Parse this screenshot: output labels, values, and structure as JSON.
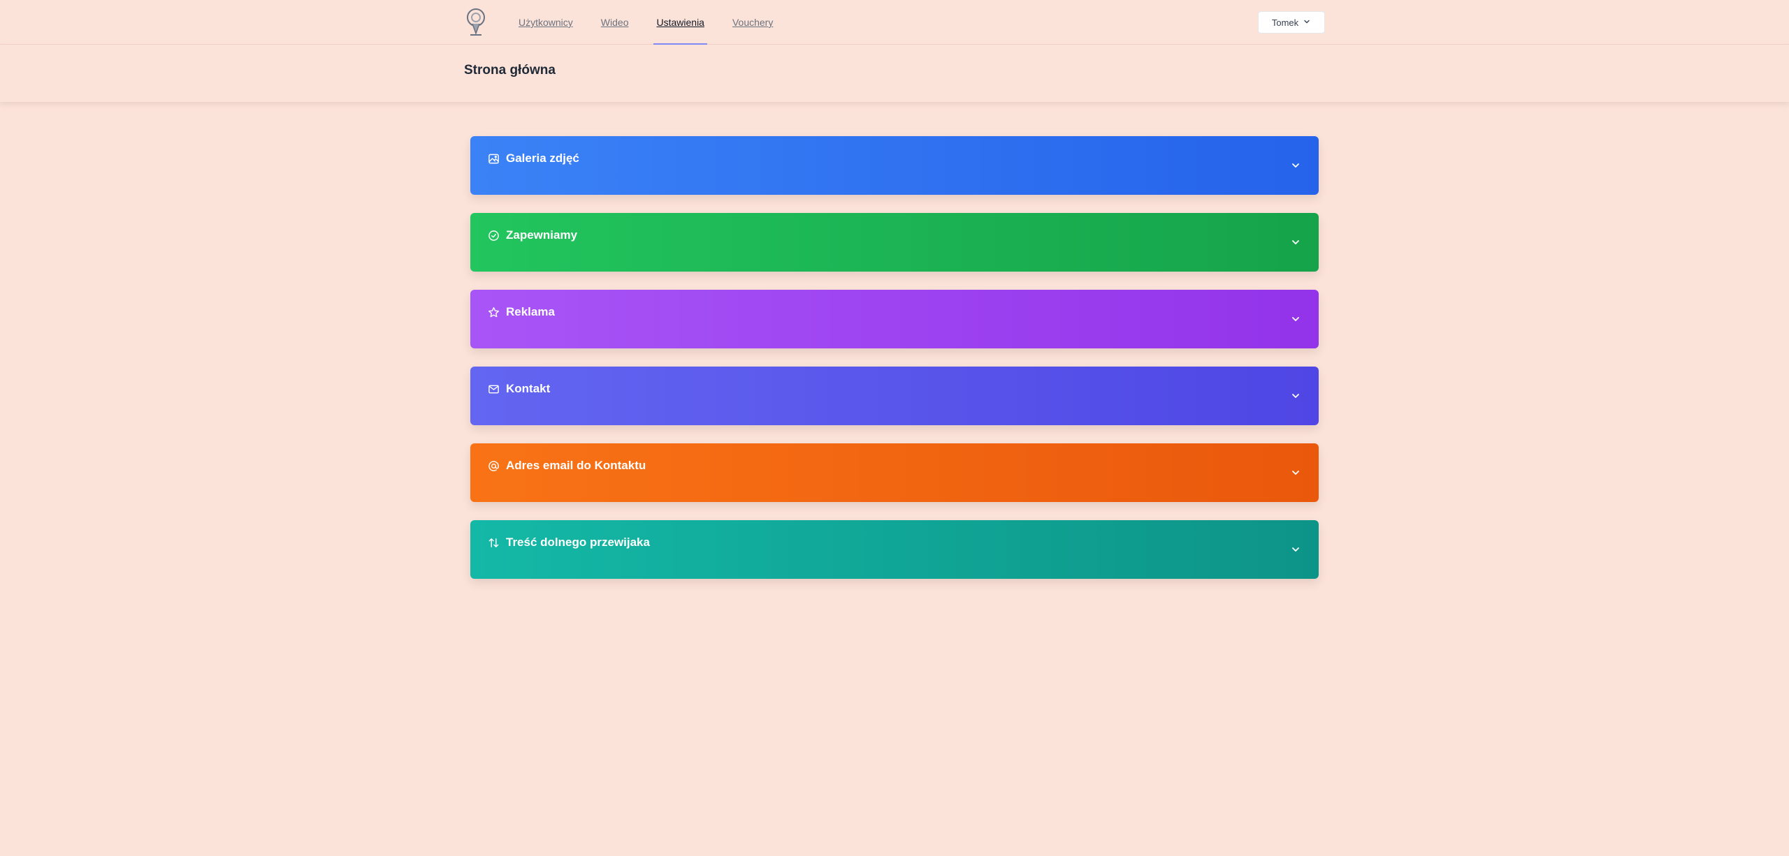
{
  "nav": {
    "links": [
      {
        "label": "Użytkownicy",
        "active": false
      },
      {
        "label": "Wideo",
        "active": false
      },
      {
        "label": "Ustawienia",
        "active": true
      },
      {
        "label": "Vouchery",
        "active": false
      }
    ],
    "user_menu": {
      "label": "Tomek",
      "icon": "chevron-down-icon"
    }
  },
  "header": {
    "title": "Strona główna"
  },
  "sections": [
    {
      "title": "Galeria zdjęć",
      "icon": "image-icon",
      "color_from": "#3b82f6",
      "color_to": "#2563eb"
    },
    {
      "title": "Zapewniamy",
      "icon": "check-circle-icon",
      "color_from": "#22c55e",
      "color_to": "#16a34a"
    },
    {
      "title": "Reklama",
      "icon": "star-icon",
      "color_from": "#a855f7",
      "color_to": "#9333ea"
    },
    {
      "title": "Kontakt",
      "icon": "mail-icon",
      "color_from": "#6366f1",
      "color_to": "#4f46e5"
    },
    {
      "title": "Adres email do Kontaktu",
      "icon": "at-sign-icon",
      "color_from": "#f97316",
      "color_to": "#ea580c"
    },
    {
      "title": "Treść dolnego przewijaka",
      "icon": "arrows-up-down-icon",
      "color_from": "#14b8a6",
      "color_to": "#0d9488"
    }
  ]
}
